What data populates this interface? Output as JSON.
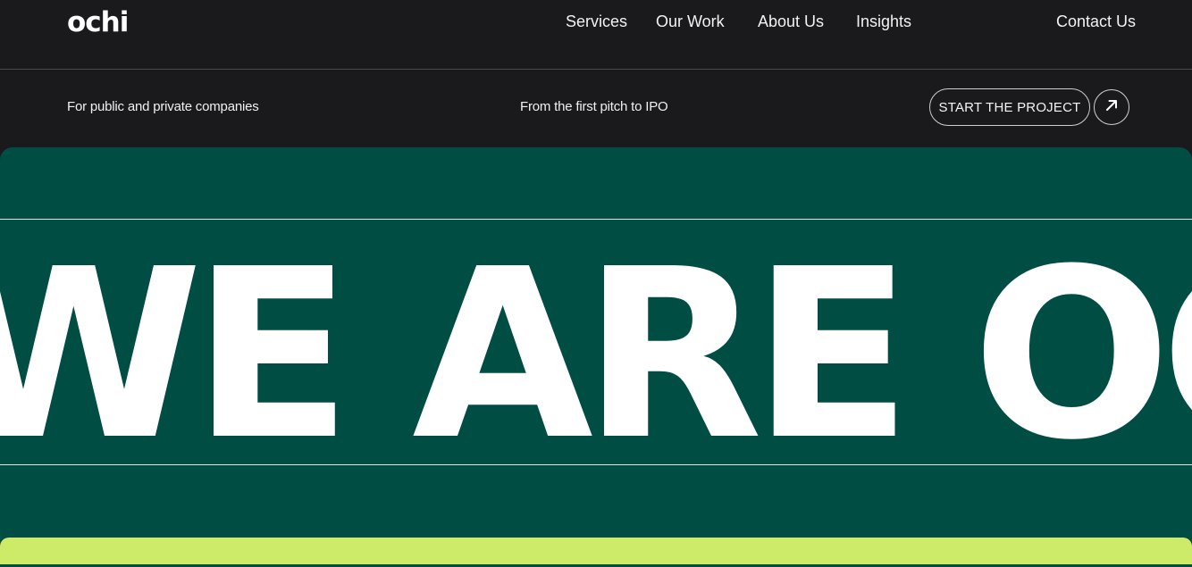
{
  "nav": {
    "logo": "ochi",
    "links": [
      "Services",
      "Our Work",
      "About Us",
      "Insights"
    ],
    "contact": "Contact Us"
  },
  "subheader": {
    "left_text": "For public and private companies",
    "middle_text": "From the first pitch to IPO",
    "cta_label": "START THE PROJECT",
    "cta_icon": "arrow-up-right-icon"
  },
  "hero": {
    "marquee_text": "WE ARE OCHI",
    "background_color": "#004d43"
  },
  "next_section": {
    "background_color": "#cdea68"
  }
}
